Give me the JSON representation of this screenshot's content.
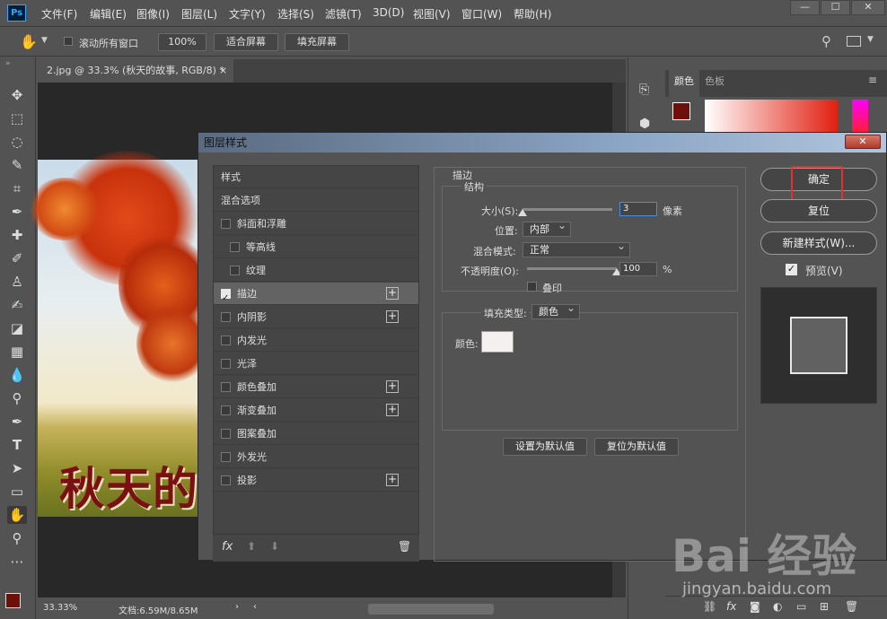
{
  "menubar": {
    "logo": "Ps",
    "items": [
      "文件(F)",
      "编辑(E)",
      "图像(I)",
      "图层(L)",
      "文字(Y)",
      "选择(S)",
      "滤镜(T)",
      "3D(D)",
      "视图(V)",
      "窗口(W)",
      "帮助(H)"
    ],
    "win_min": "—",
    "win_max": "☐",
    "win_close": "✕"
  },
  "options": {
    "scroll_all": "滚动所有窗口",
    "zoom": "100%",
    "fit_screen": "适合屏幕",
    "fill_screen": "填充屏幕"
  },
  "document": {
    "tab_label": "2.jpg @ 33.3% (秋天的故事, RGB/8) *",
    "tab_close": "×",
    "photo_text": "秋天的"
  },
  "status": {
    "zoom": "33.33%",
    "doc": "文档:6.59M/8.65M"
  },
  "panel": {
    "tab_color": "颜色",
    "tab_swatches": "色板",
    "menu_icon": "≡",
    "fg_color": "#6e0f0a",
    "bg_color": "#ffffff"
  },
  "dialog": {
    "title": "图层样式",
    "close": "✕",
    "styles_header": "样式",
    "blend_options": "混合选项",
    "items": [
      {
        "label": "斜面和浮雕",
        "checked": false,
        "plus": false,
        "indent": false
      },
      {
        "label": "等高线",
        "checked": false,
        "plus": false,
        "indent": true
      },
      {
        "label": "纹理",
        "checked": false,
        "plus": false,
        "indent": true
      },
      {
        "label": "描边",
        "checked": true,
        "plus": true,
        "indent": false,
        "selected": true
      },
      {
        "label": "内阴影",
        "checked": false,
        "plus": true,
        "indent": false
      },
      {
        "label": "内发光",
        "checked": false,
        "plus": false,
        "indent": false
      },
      {
        "label": "光泽",
        "checked": false,
        "plus": false,
        "indent": false
      },
      {
        "label": "颜色叠加",
        "checked": false,
        "plus": true,
        "indent": false
      },
      {
        "label": "渐变叠加",
        "checked": false,
        "plus": true,
        "indent": false
      },
      {
        "label": "图案叠加",
        "checked": false,
        "plus": false,
        "indent": false
      },
      {
        "label": "外发光",
        "checked": false,
        "plus": false,
        "indent": false
      },
      {
        "label": "投影",
        "checked": false,
        "plus": true,
        "indent": false
      }
    ],
    "fx": "fx",
    "stroke": {
      "section": "描边",
      "structure": "结构",
      "size_label": "大小(S):",
      "size_value": "3",
      "size_unit": "像素",
      "position_label": "位置:",
      "position_value": "内部",
      "blend_label": "混合模式:",
      "blend_value": "正常",
      "opacity_label": "不透明度(O):",
      "opacity_value": "100",
      "opacity_unit": "%",
      "overprint_label": "叠印",
      "fill_type_label": "填充类型:",
      "fill_type_value": "颜色",
      "color_label": "颜色:",
      "color_value": "#f4f0f0",
      "size_fraction": 0.0,
      "opacity_fraction": 1.0
    },
    "set_default": "设置为默认值",
    "reset_default": "复位为默认值",
    "ok": "确定",
    "reset": "复位",
    "new_style": "新建样式(W)...",
    "preview_label": "预览(V)"
  },
  "watermark": {
    "main": "Bai 经验",
    "sub": "jingyan.baidu.com"
  }
}
